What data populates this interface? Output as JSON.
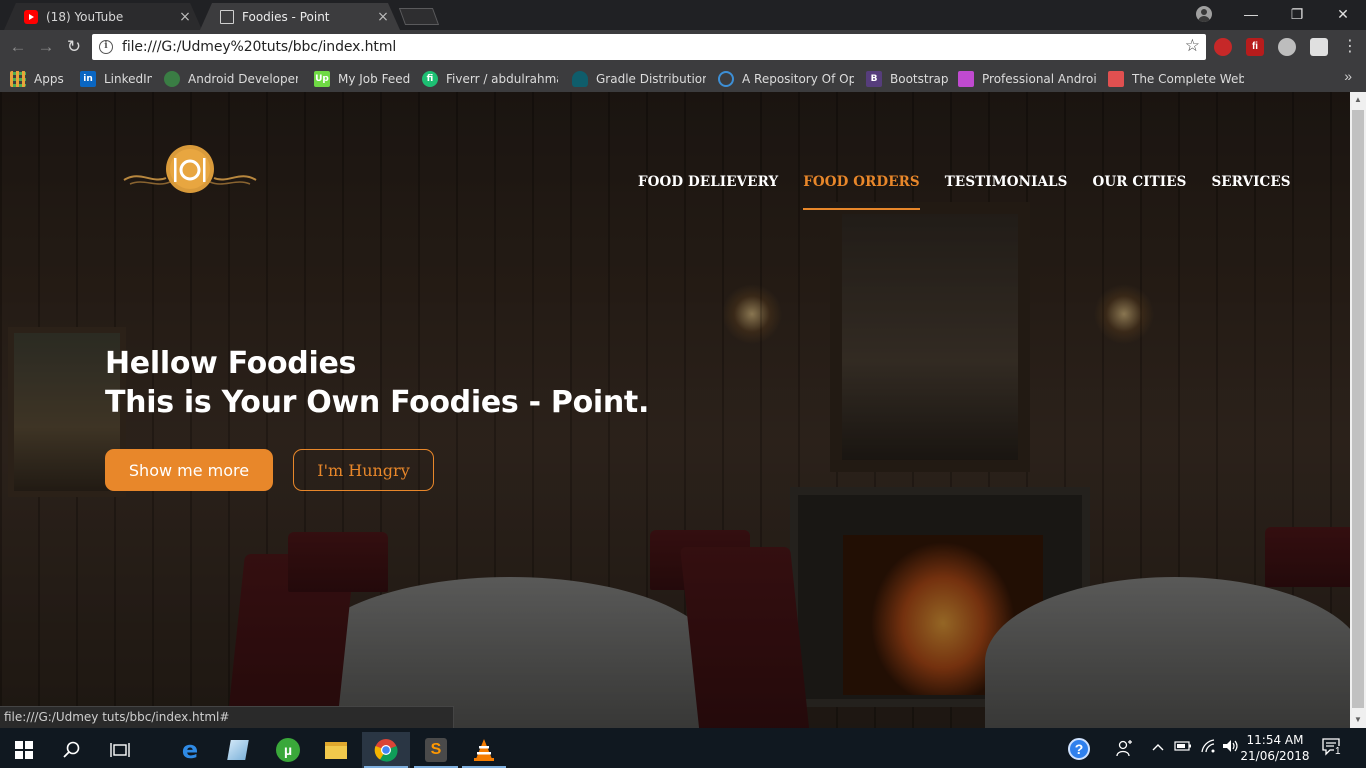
{
  "browser": {
    "tabs": [
      {
        "title": "(18) YouTube",
        "close": "×"
      },
      {
        "title": "Foodies - Point",
        "close": "×"
      }
    ],
    "window_controls": {
      "minimize": "—",
      "maximize": "❐",
      "close": "✕"
    },
    "nav": {
      "back": "←",
      "forward": "→",
      "reload": "↻"
    },
    "url": "file:///G:/Udmey%20tuts/bbc/index.html",
    "star": "☆",
    "menu": "⋮",
    "bookmarks": [
      {
        "label": "Apps",
        "icon": "apps-grid-icon",
        "color": "#e8a33a"
      },
      {
        "label": "LinkedIn",
        "icon": "linkedin-icon",
        "color": "#0a66c2"
      },
      {
        "label": "Android Developer",
        "icon": "android-studio-icon",
        "color": "#3a7d44"
      },
      {
        "label": "My Job Feed",
        "icon": "upwork-icon",
        "color": "#6fda44"
      },
      {
        "label": "Fiverr / abdulrahman",
        "icon": "fiverr-icon",
        "color": "#1dbf73"
      },
      {
        "label": "Gradle Distributions",
        "icon": "gradle-icon",
        "color": "#02303a"
      },
      {
        "label": "A Repository Of Ope",
        "icon": "repository-icon",
        "color": "#3d8fd6"
      },
      {
        "label": "Bootstrap",
        "icon": "bootstrap-icon",
        "color": "#563d7c"
      },
      {
        "label": "Professional Androic",
        "icon": "professional-android-icon",
        "color": "#c04ad0"
      },
      {
        "label": "The Complete Web",
        "icon": "complete-web-icon",
        "color": "#e05050"
      }
    ],
    "bookmarks_more": "»",
    "status_url": "file:///G:/Udmey tuts/bbc/index.html#"
  },
  "site": {
    "nav": [
      {
        "label": "FOOD DELIEVERY",
        "active": false
      },
      {
        "label": "FOOD ORDERS",
        "active": true
      },
      {
        "label": "TESTIMONIALS",
        "active": false
      },
      {
        "label": "OUR CITIES",
        "active": false
      },
      {
        "label": "SERVICES",
        "active": false
      }
    ],
    "hero": {
      "line1": "Hellow Foodies",
      "line2": "This is Your Own Foodies - Point."
    },
    "buttons": {
      "primary": "Show me more",
      "secondary": "I'm Hungry"
    },
    "accent_color": "#e8872a"
  },
  "taskbar": {
    "time": "11:54 AM",
    "date": "21/06/2018",
    "notifications": "1"
  }
}
